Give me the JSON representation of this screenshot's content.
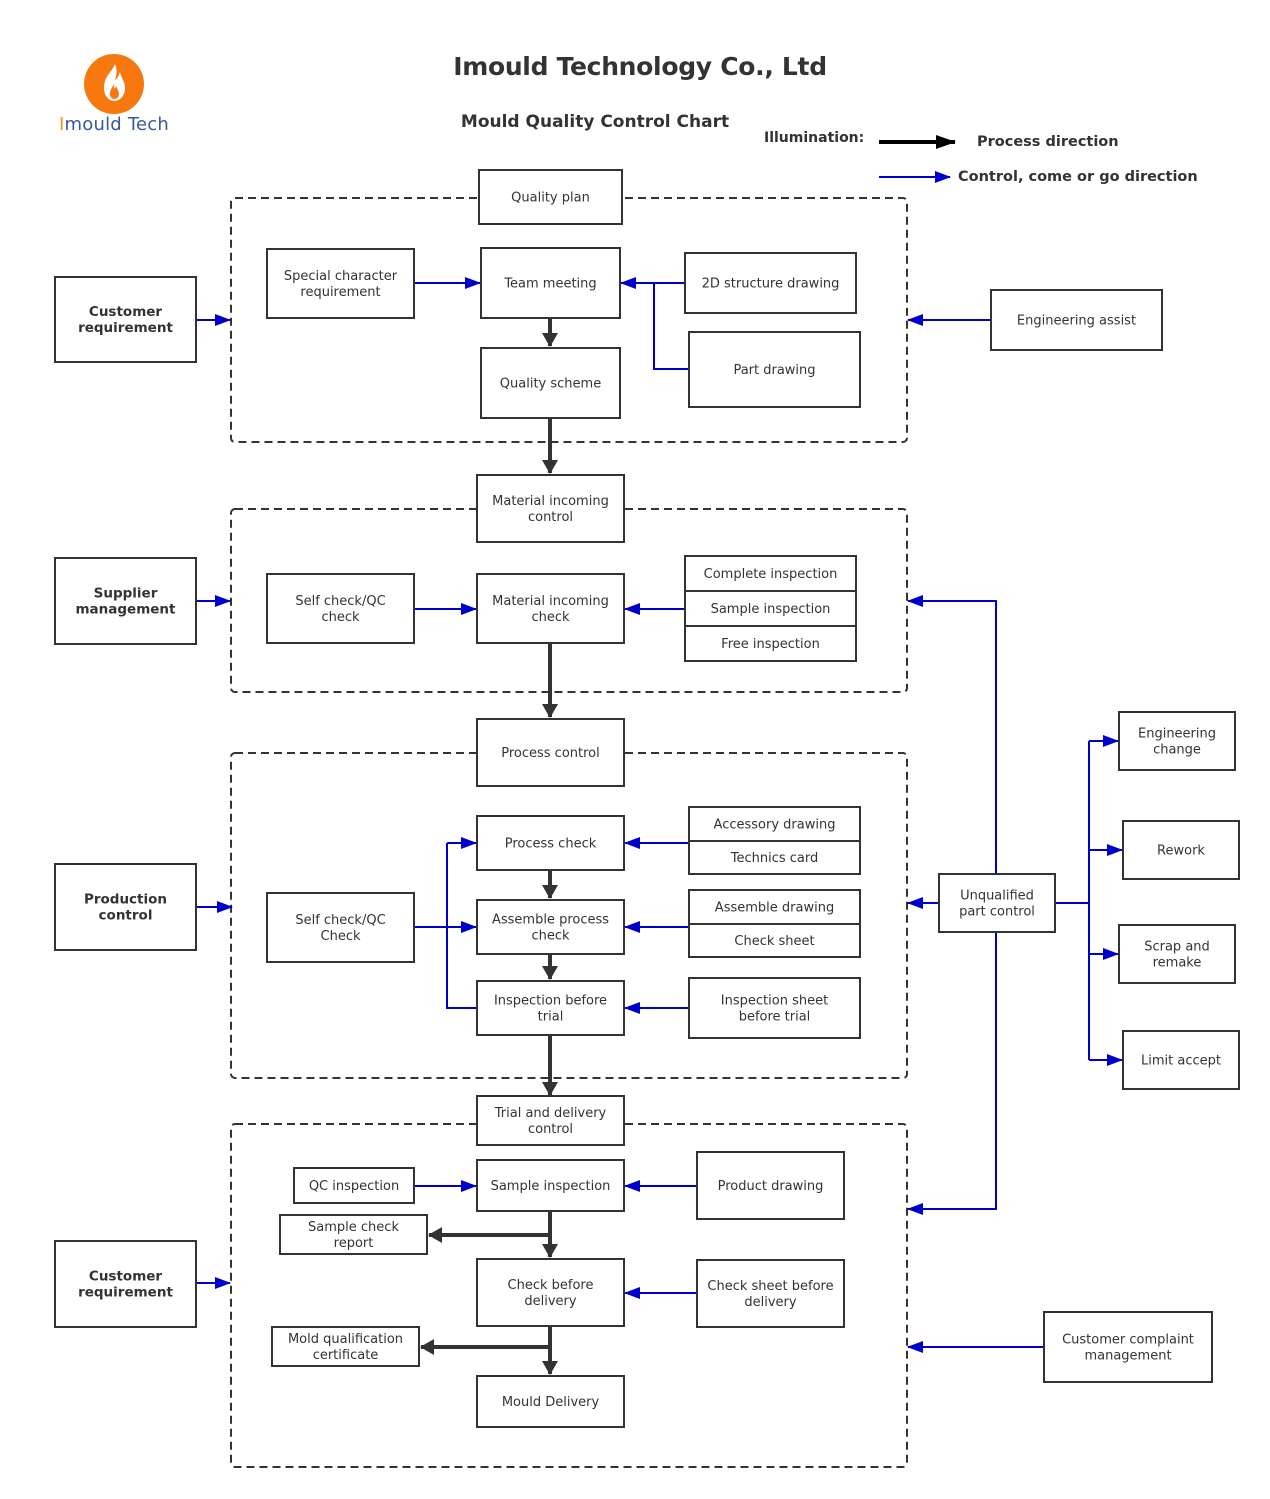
{
  "header": {
    "company_title": "Imould Technology Co., Ltd",
    "chart_title": "Mould Quality Control Chart",
    "logo": {
      "icon": "flame-icon",
      "text_first_letter": "I",
      "text_rest": "mould Tech",
      "circle_color": "#f7780f",
      "text_color": "#3a56a0",
      "accent_color": "#f08a22"
    }
  },
  "legend": {
    "label": "Illumination:",
    "process": "Process direction",
    "control": "Control, come or go direction",
    "process_color": "#000000",
    "control_color": "#0000cc"
  },
  "groups": {
    "quality_plan": {
      "header": "Quality plan",
      "special_character": "Special character requirement",
      "team_meeting": "Team meeting",
      "quality_scheme": "Quality scheme",
      "structure_drawing": "2D structure drawing",
      "part_drawing": "Part drawing"
    },
    "material": {
      "header": "Material incoming control",
      "self_check": "Self check/QC check",
      "incoming_check": "Material incoming check",
      "inspections": [
        "Complete inspection",
        "Sample inspection",
        "Free inspection"
      ]
    },
    "process": {
      "header": "Process control",
      "self_check": "Self check/QC Check",
      "process_check": "Process check",
      "assemble_check": "Assemble process check",
      "inspection_before_trial": "Inspection before trial",
      "accessory_docs": [
        "Accessory drawing",
        "Technics card"
      ],
      "assemble_docs": [
        "Assemble drawing",
        "Check sheet"
      ],
      "inspection_sheet": "Inspection sheet before trial"
    },
    "trial": {
      "header": "Trial and delivery control",
      "qc_inspection": "QC inspection",
      "sample_inspection": "Sample inspection",
      "product_drawing": "Product drawing",
      "sample_check_report": "Sample check report",
      "check_before_delivery": "Check before delivery",
      "check_sheet_before_delivery": "Check sheet before delivery",
      "mold_certificate": "Mold qualification certificate",
      "mould_delivery": "Mould Delivery"
    }
  },
  "left_inputs": {
    "customer_requirement_top": "Customer requirement",
    "supplier_management": "Supplier management",
    "production_control": "Production control",
    "customer_requirement_bottom": "Customer requirement"
  },
  "right_side": {
    "engineering_assist": "Engineering assist",
    "unqualified_part_control": "Unqualified part control",
    "outcomes": [
      "Engineering change",
      "Rework",
      "Scrap and remake",
      "Limit accept"
    ],
    "customer_complaint": "Customer complaint management"
  }
}
